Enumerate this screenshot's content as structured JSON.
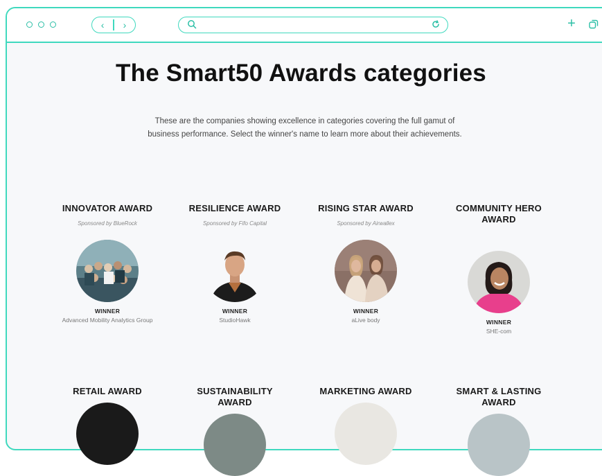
{
  "browser": {
    "url_value": "",
    "back_glyph": "‹",
    "forward_glyph": "›",
    "new_tab_glyph": "+"
  },
  "page": {
    "title": "The Smart50 Awards categories",
    "intro": "These are the companies showing excellence in categories covering the full gamut of business performance. Select the winner's name to learn more about their achievements."
  },
  "awards_row1": [
    {
      "title": "INNOVATOR AWARD",
      "sponsor": "Sponsored by BlueRock",
      "winner_label": "WINNER",
      "winner": "Advanced Mobility Analytics Group",
      "photo": "team-photo"
    },
    {
      "title": "RESILIENCE AWARD",
      "sponsor": "Sponsored by Fifo Capital",
      "winner_label": "WINNER",
      "winner": "StudioHawk",
      "photo": "man-portrait"
    },
    {
      "title": "RISING STAR AWARD",
      "sponsor": "Sponsored by Airwallex",
      "winner_label": "WINNER",
      "winner": "aLive body",
      "photo": "two-women-photo"
    },
    {
      "title": "COMMUNITY HERO AWARD",
      "sponsor": "",
      "winner_label": "WINNER",
      "winner": "SHE-com",
      "photo": "woman-portrait"
    }
  ],
  "awards_row2": [
    {
      "title": "RETAIL AWARD"
    },
    {
      "title": "SUSTAINABILITY AWARD"
    },
    {
      "title": "MARKETING AWARD"
    },
    {
      "title": "SMART & LASTING AWARD"
    }
  ],
  "colors": {
    "accent": "#3fd9be",
    "background": "#f7f8fa",
    "title": "#111111"
  }
}
